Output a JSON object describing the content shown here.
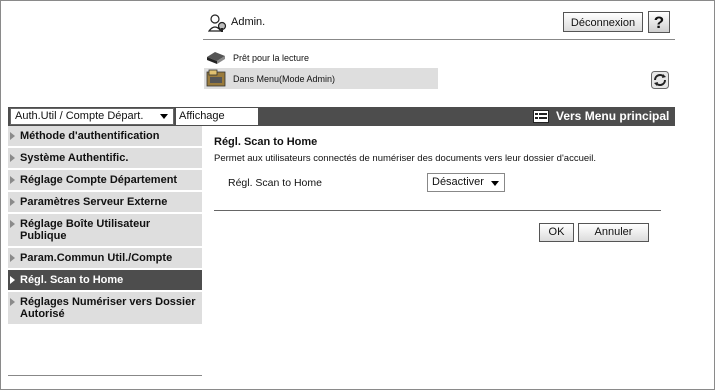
{
  "header": {
    "user_name": "Admin.",
    "logout_label": "Déconnexion",
    "help_label": "?",
    "status_text": "Prêt pour la lecture",
    "mode_text": "Dans Menu(Mode Admin)"
  },
  "nav": {
    "category_select": "Auth.Util / Compte Départ.",
    "display_tab": "Affichage",
    "main_menu_label": "Vers Menu principal"
  },
  "sidebar": {
    "items": [
      {
        "label": "Méthode d'authentification",
        "active": false
      },
      {
        "label": "Système Authentific.",
        "active": false
      },
      {
        "label": "Réglage Compte Département",
        "active": false
      },
      {
        "label": "Paramètres Serveur Externe",
        "active": false
      },
      {
        "label": "Réglage Boîte Utilisateur Publique",
        "active": false
      },
      {
        "label": "Param.Commun Util./Compte",
        "active": false
      },
      {
        "label": "Régl. Scan to Home",
        "active": true
      },
      {
        "label": "Réglages Numériser vers Dossier Autorisé",
        "active": false
      }
    ]
  },
  "content": {
    "title": "Régl. Scan to Home",
    "description": "Permet aux utilisateurs connectés de numériser des documents vers leur dossier d'accueil.",
    "field_label": "Régl. Scan to Home",
    "field_value": "Désactiver",
    "ok_label": "OK",
    "cancel_label": "Annuler"
  },
  "colors": {
    "nav_bar": "#4d4d4d",
    "sidebar_item": "#dedede",
    "sidebar_active": "#4d4d4d"
  },
  "icons": {
    "user": "admin-user-icon",
    "printer": "printer-icon",
    "mode": "admin-mode-icon",
    "refresh": "refresh-icon",
    "menu": "main-menu-icon"
  }
}
